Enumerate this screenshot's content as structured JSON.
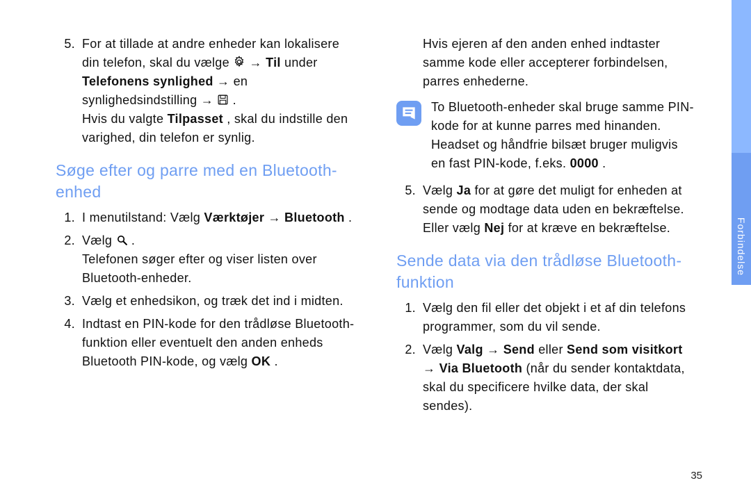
{
  "sideTab": {
    "label": "Forbindelse"
  },
  "pageNumber": "35",
  "left": {
    "step5": {
      "num": "5.",
      "line1_pre": "For at tillade at andre enheder kan lokalisere din telefon, skal du vælge ",
      "line1_post_gear": " → ",
      "til": "Til",
      "line1_end": " under ",
      "telefonens": "Telefonens synlighed",
      "arrow2": " → en synlighedsindstilling → ",
      "line2_pre": "Hvis du valgte ",
      "tilpasset": "Tilpasset",
      "line2_post": ", skal du indstille den varighed, din telefon er synlig."
    },
    "heading1": "Søge efter og parre med en Bluetooth-enhed",
    "s1": {
      "num": "1.",
      "pre": "I menutilstand: Vælg ",
      "b": "Værktøjer",
      "mid": " → ",
      "b2": "Bluetooth",
      "end": "."
    },
    "s2": {
      "num": "2.",
      "pre": "Vælg ",
      "post": ".",
      "after": "Telefonen søger efter og viser listen over Bluetooth-enheder."
    },
    "s3": {
      "num": "3.",
      "txt": "Vælg et enhedsikon, og træk det ind i midten."
    },
    "s4": {
      "num": "4.",
      "pre": "Indtast en PIN-kode for den trådløse Bluetooth-funktion eller eventuelt den anden enheds Bluetooth PIN-kode, og vælg ",
      "ok": "OK",
      "end": "."
    }
  },
  "right": {
    "cont": "Hvis ejeren af den anden enhed indtaster samme kode eller accepterer forbindelsen, parres enhederne.",
    "note": {
      "pre": "To Bluetooth-enheder skal bruge samme PIN-kode for at kunne parres med hinanden. Headset og håndfrie bilsæt bruger muligvis en fast PIN-kode, f.eks. ",
      "pin": "0000",
      "end": "."
    },
    "s5": {
      "num": "5.",
      "pre": "Vælg ",
      "ja": "Ja",
      "mid": " for at gøre det muligt for enheden at sende og modtage data uden en bekræftelse. Eller vælg ",
      "nej": "Nej",
      "end": " for at kræve en bekræftelse."
    },
    "heading2": "Sende data via den trådløse Bluetooth-funktion",
    "t1": {
      "num": "1.",
      "txt": "Vælg den fil eller det objekt i et af din telefons programmer, som du vil sende."
    },
    "t2": {
      "num": "2.",
      "pre": "Vælg ",
      "valg": "Valg",
      "a1": " → ",
      "send": "Send",
      "mid1": " eller ",
      "sendsom": "Send som visitkort",
      "a2": " → ",
      "via": "Via Bluetooth",
      "end": " (når du sender kontaktdata, skal du specificere hvilke data, der skal sendes)."
    }
  }
}
